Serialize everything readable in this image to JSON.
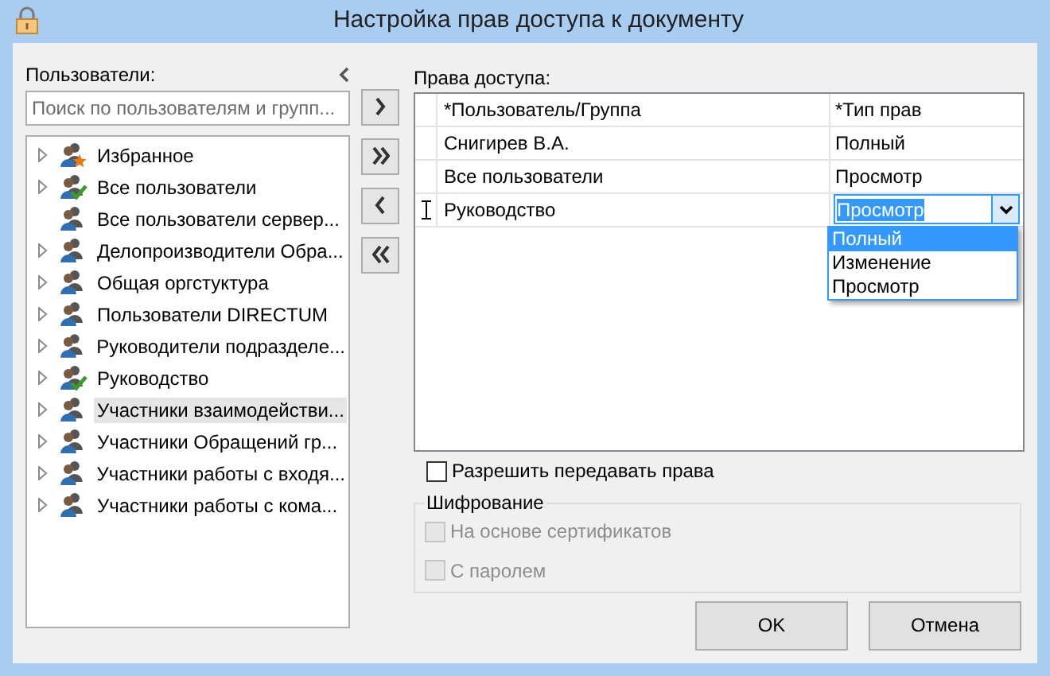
{
  "window": {
    "title": "Настройка прав доступа к документу"
  },
  "users_panel": {
    "label": "Пользователи:",
    "search": {
      "placeholder": "Поиск по пользователям и групп..."
    },
    "tree": [
      {
        "name": "Избранное",
        "kind": "favorites",
        "expandable": true,
        "selected": false
      },
      {
        "name": "Все пользователи",
        "kind": "checked-group",
        "expandable": true,
        "selected": false
      },
      {
        "name": "Все пользователи сервер...",
        "kind": "group",
        "expandable": false,
        "selected": false
      },
      {
        "name": "Делопроизводители Обра...",
        "kind": "group",
        "expandable": true,
        "selected": false
      },
      {
        "name": "Общая оргстуктура",
        "kind": "group",
        "expandable": true,
        "selected": false
      },
      {
        "name": "Пользователи DIRECTUM",
        "kind": "group",
        "expandable": true,
        "selected": false
      },
      {
        "name": "Руководители подразделе...",
        "kind": "group",
        "expandable": true,
        "selected": false
      },
      {
        "name": "Руководство",
        "kind": "checked-group",
        "expandable": true,
        "selected": false
      },
      {
        "name": "Участники взаимодействи...",
        "kind": "group",
        "expandable": true,
        "selected": true
      },
      {
        "name": "Участники Обращений гр...",
        "kind": "group",
        "expandable": true,
        "selected": false
      },
      {
        "name": "Участники работы с входя...",
        "kind": "group",
        "expandable": true,
        "selected": false
      },
      {
        "name": "Участники работы с кома...",
        "kind": "group",
        "expandable": true,
        "selected": false
      }
    ]
  },
  "rights": {
    "label": "Права доступа:",
    "columns": [
      "*Пользователь/Группа",
      "*Тип прав"
    ],
    "rows": [
      {
        "user": "Снигирев В.А.",
        "type": "Полный",
        "editing": false
      },
      {
        "user": "Все пользователи",
        "type": "Просмотр",
        "editing": false
      },
      {
        "user": "Руководство",
        "type": "Просмотр",
        "editing": true
      }
    ],
    "dropdown": {
      "options": [
        {
          "label": "Полный",
          "selected": true
        },
        {
          "label": "Изменение",
          "selected": false
        },
        {
          "label": "Просмотр",
          "selected": false
        }
      ]
    }
  },
  "allow_transfer": {
    "label": "Разрешить передавать права",
    "checked": false
  },
  "encryption": {
    "title": "Шифрование",
    "options": [
      {
        "label": "На основе сертификатов",
        "checked": false,
        "disabled": true
      },
      {
        "label": "С паролем",
        "checked": false,
        "disabled": true
      }
    ]
  },
  "buttons": [
    "OK",
    "Отмена"
  ]
}
